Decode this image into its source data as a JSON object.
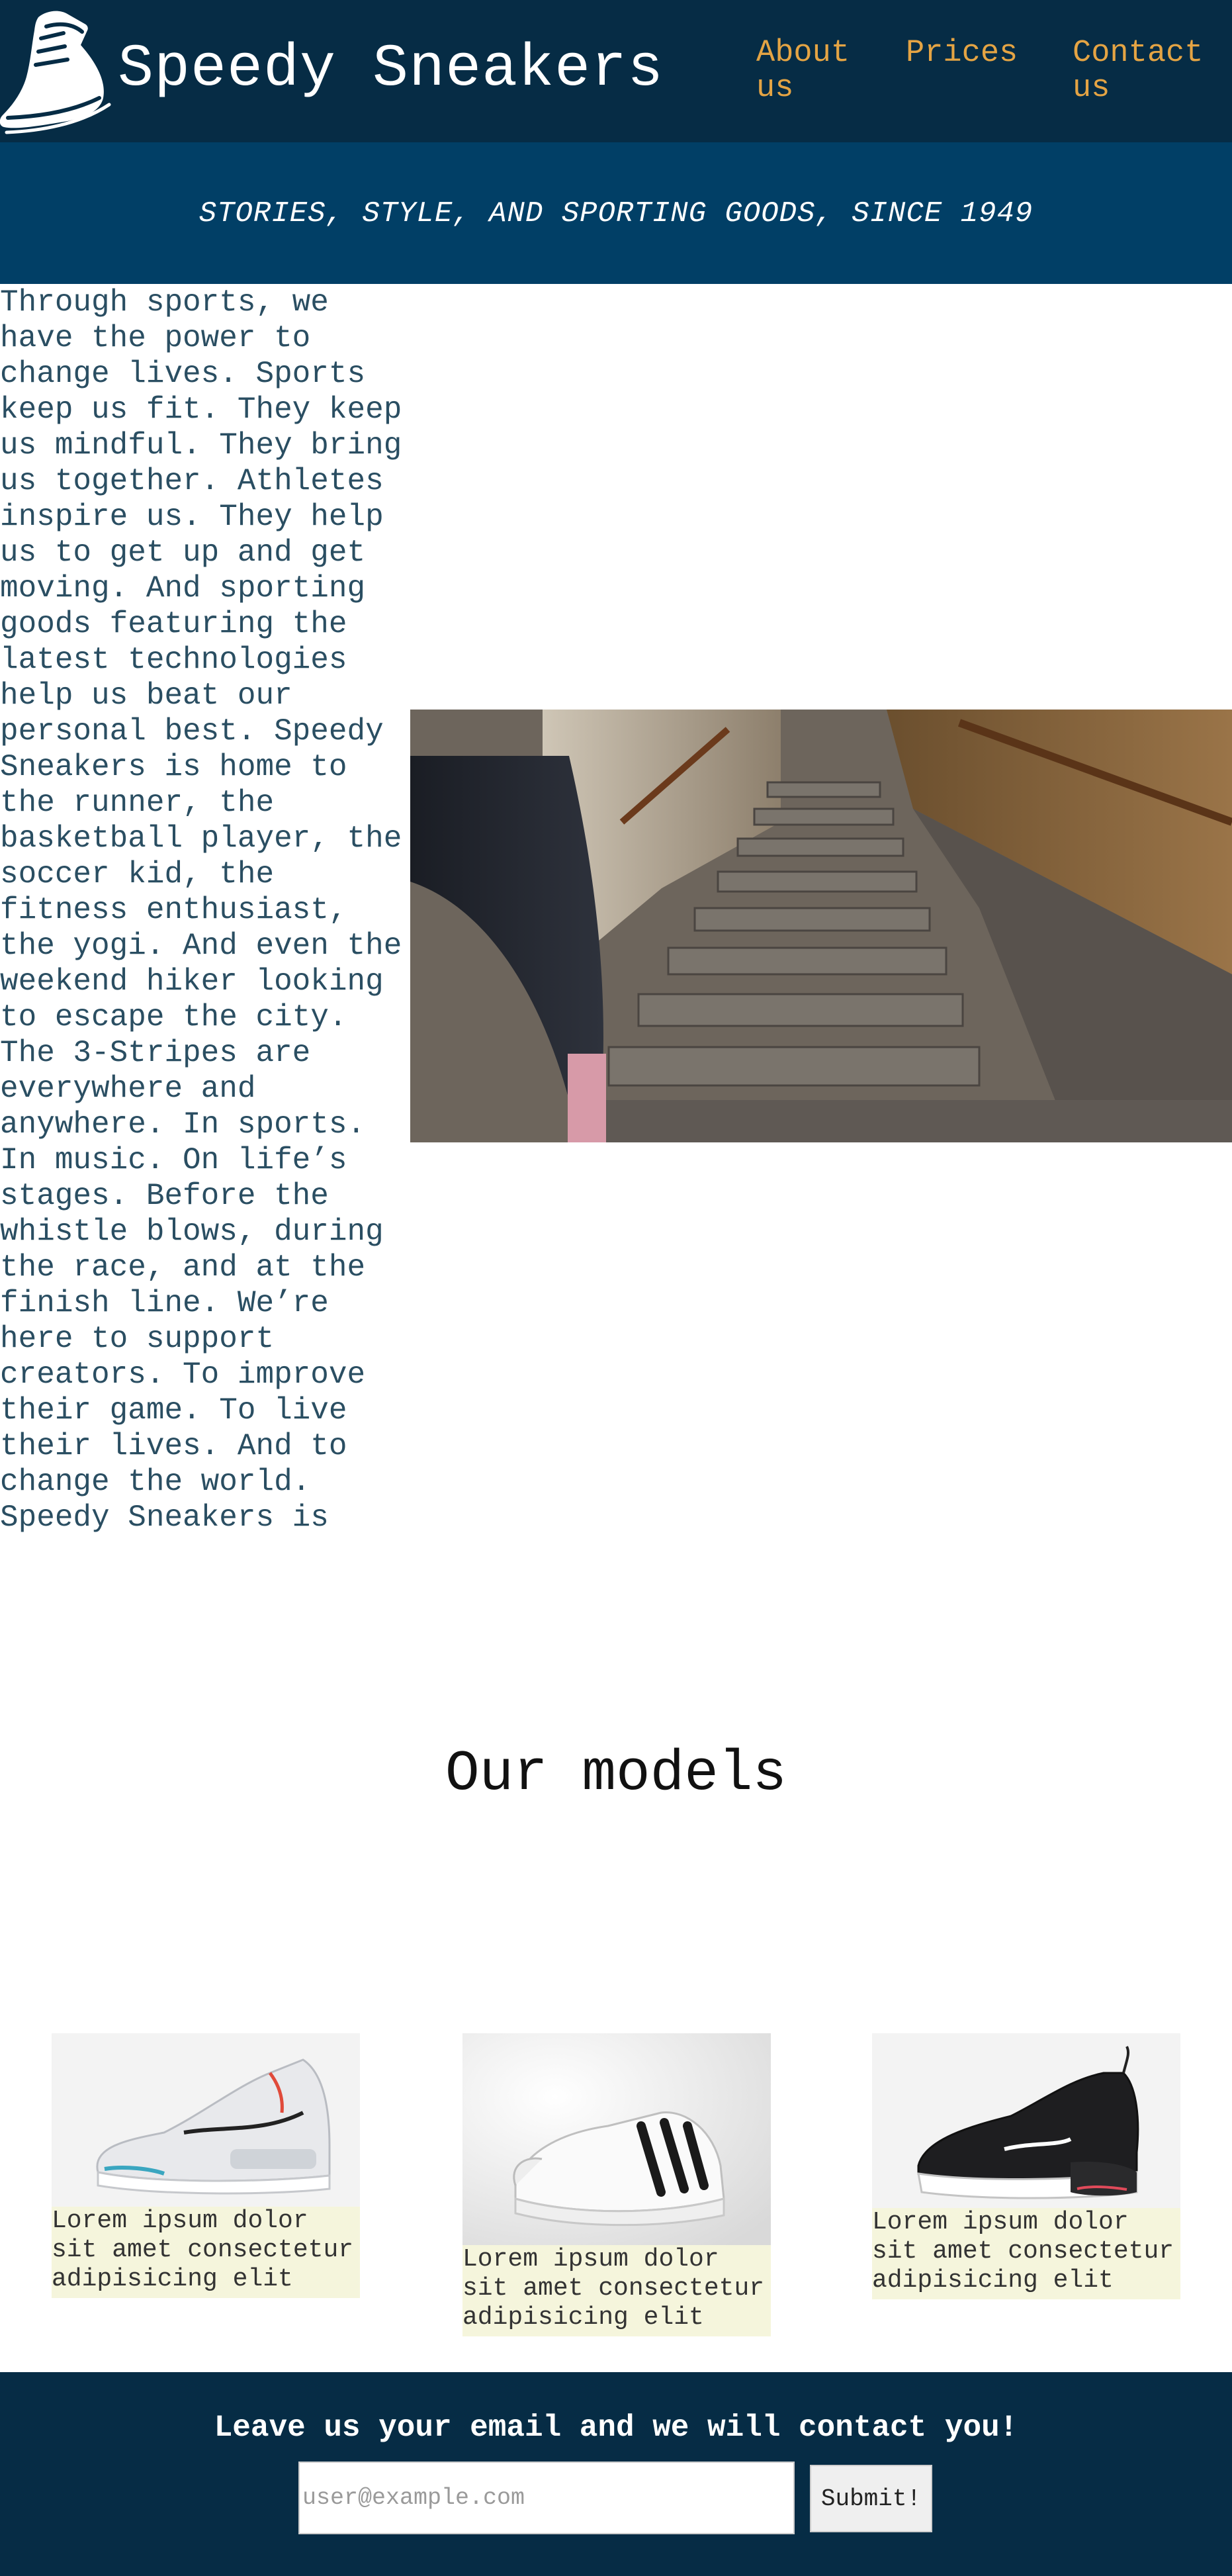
{
  "header": {
    "brand": "Speedy Sneakers",
    "logo_icon": "running-shoe-icon",
    "nav": [
      {
        "label": "About\nus"
      },
      {
        "label": "Prices"
      },
      {
        "label": "Contact\nus"
      }
    ],
    "colors": {
      "background": "#062c45",
      "nav_link": "#e4a444"
    }
  },
  "tagline": "STORIES, STYLE, AND SPORTING GOODS, SINCE 1949",
  "article": {
    "text": "Through sports, we have the power to change lives. Sports keep us fit. They keep us mindful. They bring us together. Athletes inspire us. They help us to get up and get moving. And sporting goods featuring the latest technologies help us beat our personal best. Speedy Sneakers is home to the runner, the basketball player, the soccer kid, the fitness enthusiast, the yogi. And even the weekend hiker looking to escape the city. The 3-Stripes are everywhere and anywhere. In sports. In music. On life’s stages. Before the whistle blows, during the race, and at the finish line. We’re here to support creators. To improve their game. To live their lives. And to change the world. Speedy Sneakers is",
    "hero_image": "stone-staircase-runner-photo"
  },
  "models": {
    "title": "Our models",
    "cards": [
      {
        "image": "white-air-max-sneaker-photo",
        "caption": "Lorem ipsum dolor sit amet consectetur adipisicing elit"
      },
      {
        "image": "white-superstar-sneaker-photo",
        "caption": "Lorem ipsum dolor sit amet consectetur adipisicing elit"
      },
      {
        "image": "black-air-max-270-sneaker-photo",
        "caption": "Lorem ipsum dolor sit amet consectetur adipisicing elit"
      }
    ]
  },
  "footer": {
    "heading": "Leave us your email and we will contact you!",
    "email_placeholder": "user@example.com",
    "submit_label": "Submit!"
  }
}
